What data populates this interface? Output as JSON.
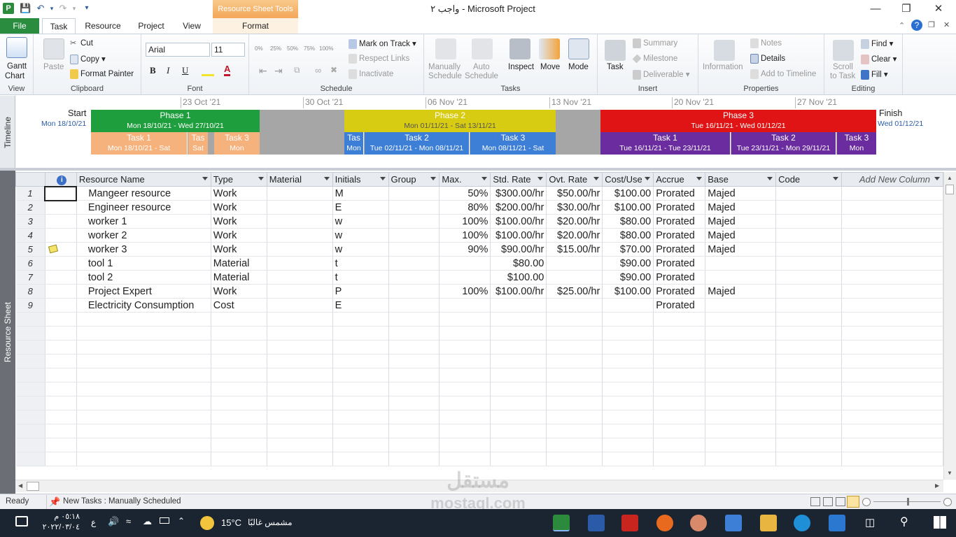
{
  "titlebar": {
    "title": "واجب ٢  -  Microsoft Project",
    "context_tab_header": "Resource Sheet Tools"
  },
  "tabs": [
    "File",
    "Task",
    "Resource",
    "Project",
    "View",
    "Format"
  ],
  "ribbon": {
    "view": {
      "gantt": "Gantt",
      "chart": "Chart",
      "label": "View"
    },
    "clipboard": {
      "paste": "Paste",
      "cut": "Cut",
      "copy": "Copy",
      "format_painter": "Format Painter",
      "label": "Clipboard"
    },
    "font": {
      "name": "Arial",
      "size": "11",
      "label": "Font"
    },
    "schedule": {
      "percents": [
        "0%",
        "25%",
        "50%",
        "75%",
        "100%"
      ],
      "mark_on_track": "Mark on Track",
      "respect_links": "Respect Links",
      "inactivate": "Inactivate",
      "label": "Schedule"
    },
    "tasks": {
      "manually": "Manually",
      "manually2": "Schedule",
      "auto": "Auto",
      "auto2": "Schedule",
      "inspect": "Inspect",
      "move": "Move",
      "mode": "Mode",
      "label": "Tasks"
    },
    "insert": {
      "task": "Task",
      "summary": "Summary",
      "milestone": "Milestone",
      "deliverable": "Deliverable",
      "label": "Insert"
    },
    "properties": {
      "information": "Information",
      "notes": "Notes",
      "details": "Details",
      "add_to_timeline": "Add to Timeline",
      "label": "Properties"
    },
    "editing": {
      "scroll": "Scroll",
      "scroll2": "to Task",
      "find": "Find",
      "clear": "Clear",
      "fill": "Fill",
      "label": "Editing"
    }
  },
  "timeline": {
    "side_label": "Timeline",
    "start_label": "Start",
    "start_date": "Mon 18/10/21",
    "finish_label": "Finish",
    "finish_date": "Wed 01/12/21",
    "date_headers": [
      "23 Oct '21",
      "30 Oct '21",
      "06 Nov '21",
      "13 Nov '21",
      "20 Nov '21",
      "27 Nov '21"
    ],
    "phases": [
      {
        "name": "Phase 1",
        "dates": "Mon 18/10/21 - Wed 27/10/21",
        "color": "#1f9e3e"
      },
      {
        "name": "Phase 2",
        "dates": "Mon 01/11/21 - Sat 13/11/21",
        "color": "#d8cc12"
      },
      {
        "name": "Phase 3",
        "dates": "Tue 16/11/21 - Wed 01/12/21",
        "color": "#e01414"
      }
    ],
    "tasks": [
      {
        "name": "Task 1",
        "dates": "Mon 18/10/21 - Sat",
        "color": "#f5b27d"
      },
      {
        "name": "Tas",
        "dates": "Sat",
        "color": "#f5b27d"
      },
      {
        "name": "Task 3",
        "dates": "Mon",
        "color": "#f5b27d"
      },
      {
        "name": "Tas",
        "dates": "Mon",
        "color": "#3d7fd6"
      },
      {
        "name": "Task 2",
        "dates": "Tue 02/11/21 - Mon 08/11/21",
        "color": "#3d7fd6"
      },
      {
        "name": "Task 3",
        "dates": "Mon 08/11/21 - Sat",
        "color": "#3d7fd6"
      },
      {
        "name": "Task 1",
        "dates": "Tue 16/11/21 - Tue 23/11/21",
        "color": "#6a2c9e"
      },
      {
        "name": "Task 2",
        "dates": "Tue 23/11/21 - Mon 29/11/21",
        "color": "#6a2c9e"
      },
      {
        "name": "Task 3",
        "dates": "Mon",
        "color": "#6a2c9e"
      }
    ]
  },
  "sheet": {
    "side_label": "Resource Sheet",
    "columns": [
      "Resource Name",
      "Type",
      "Material",
      "Initials",
      "Group",
      "Max.",
      "Std. Rate",
      "Ovt. Rate",
      "Cost/Use",
      "Accrue",
      "Base",
      "Code",
      "Add New Column"
    ],
    "rows": [
      {
        "id": "1",
        "name": "Mangeer resource",
        "type": "Work",
        "material": "",
        "initials": "M",
        "group": "",
        "max": "50%",
        "std": "$300.00/hr",
        "ovt": "$50.00/hr",
        "cost": "$100.00",
        "accrue": "Prorated",
        "base": "Majed",
        "note": false
      },
      {
        "id": "2",
        "name": "Engineer resource",
        "type": "Work",
        "material": "",
        "initials": "E",
        "group": "",
        "max": "80%",
        "std": "$200.00/hr",
        "ovt": "$30.00/hr",
        "cost": "$100.00",
        "accrue": "Prorated",
        "base": "Majed",
        "note": false
      },
      {
        "id": "3",
        "name": "worker 1",
        "type": "Work",
        "material": "",
        "initials": "w",
        "group": "",
        "max": "100%",
        "std": "$100.00/hr",
        "ovt": "$20.00/hr",
        "cost": "$80.00",
        "accrue": "Prorated",
        "base": "Majed",
        "note": false
      },
      {
        "id": "4",
        "name": "worker 2",
        "type": "Work",
        "material": "",
        "initials": "w",
        "group": "",
        "max": "100%",
        "std": "$100.00/hr",
        "ovt": "$20.00/hr",
        "cost": "$80.00",
        "accrue": "Prorated",
        "base": "Majed",
        "note": false
      },
      {
        "id": "5",
        "name": "worker 3",
        "type": "Work",
        "material": "",
        "initials": "w",
        "group": "",
        "max": "90%",
        "std": "$90.00/hr",
        "ovt": "$15.00/hr",
        "cost": "$70.00",
        "accrue": "Prorated",
        "base": "Majed",
        "note": true
      },
      {
        "id": "6",
        "name": "tool 1",
        "type": "Material",
        "material": "",
        "initials": "t",
        "group": "",
        "max": "",
        "std": "$80.00",
        "ovt": "",
        "cost": "$90.00",
        "accrue": "Prorated",
        "base": "",
        "note": false
      },
      {
        "id": "7",
        "name": "tool 2",
        "type": "Material",
        "material": "",
        "initials": "t",
        "group": "",
        "max": "",
        "std": "$100.00",
        "ovt": "",
        "cost": "$90.00",
        "accrue": "Prorated",
        "base": "",
        "note": false
      },
      {
        "id": "8",
        "name": "Project Expert",
        "type": "Work",
        "material": "",
        "initials": "P",
        "group": "",
        "max": "100%",
        "std": "$100.00/hr",
        "ovt": "$25.00/hr",
        "cost": "$100.00",
        "accrue": "Prorated",
        "base": "Majed",
        "note": false
      },
      {
        "id": "9",
        "name": "Electricity Consumption",
        "type": "Cost",
        "material": "",
        "initials": "E",
        "group": "",
        "max": "",
        "std": "",
        "ovt": "",
        "cost": "",
        "accrue": "Prorated",
        "base": "",
        "note": false
      }
    ],
    "empty_rows": 11
  },
  "status": {
    "ready": "Ready",
    "new_tasks": "New Tasks : Manually Scheduled"
  },
  "taskbar": {
    "time": "٠٥:١٨ م",
    "date": "٢٠٢٢/٠٣/٠٤",
    "lang": "ع",
    "temp": "15°C",
    "weather": "مشمس غالبًا"
  },
  "watermark": {
    "arabic": "مستقل",
    "latin": "mostaql.com"
  }
}
